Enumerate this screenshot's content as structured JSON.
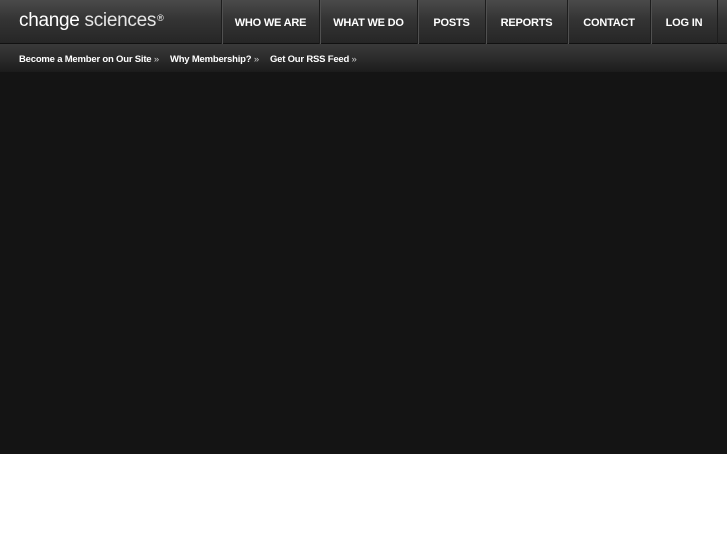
{
  "logo": {
    "part1": "change",
    "part2": "sciences",
    "mark": "®"
  },
  "nav": {
    "items": [
      {
        "label": "WHO WE ARE"
      },
      {
        "label": "WHAT WE DO"
      },
      {
        "label": "POSTS"
      },
      {
        "label": "REPORTS"
      },
      {
        "label": "CONTACT"
      },
      {
        "label": "LOG IN"
      }
    ]
  },
  "subnav": {
    "links": [
      {
        "label": "Become a Member on Our Site",
        "arrow": "»"
      },
      {
        "label": "Why Membership?",
        "arrow": "»"
      },
      {
        "label": "Get Our RSS Feed",
        "arrow": "»"
      }
    ]
  },
  "colors": {
    "topbar": "#343434",
    "hero": "#141414",
    "text": "#ffffff"
  }
}
